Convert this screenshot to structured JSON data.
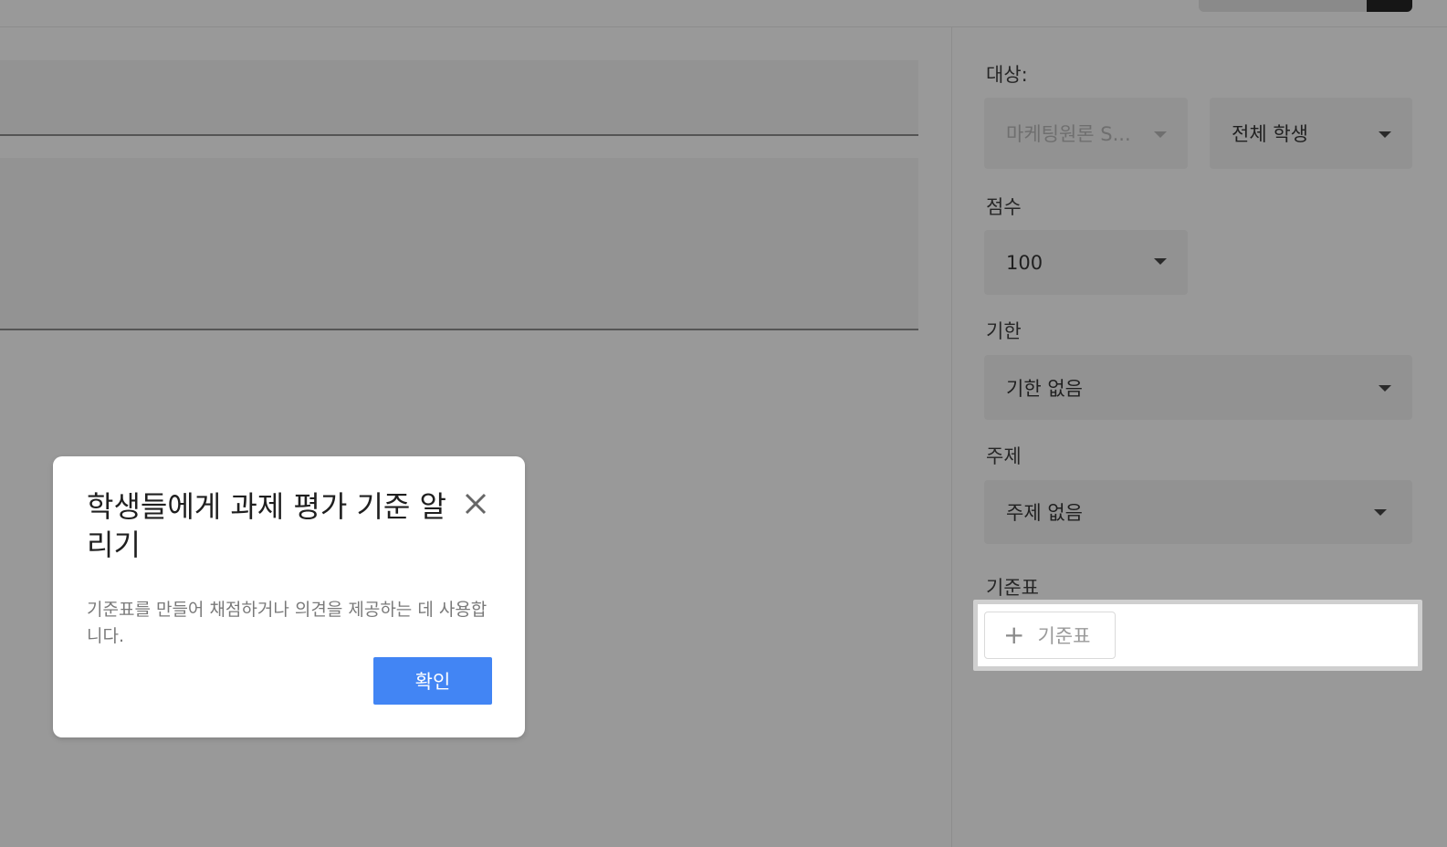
{
  "sidebar": {
    "target_label": "대상:",
    "class_dropdown": {
      "value": "마케팅원론 S..."
    },
    "students_dropdown": {
      "value": "전체 학생"
    },
    "points_label": "점수",
    "points_dropdown": {
      "value": "100"
    },
    "due_label": "기한",
    "due_dropdown": {
      "value": "기한 없음"
    },
    "topic_label": "주제",
    "topic_dropdown": {
      "value": "주제 없음"
    },
    "rubric_label": "기준표",
    "rubric_button_label": "기준표"
  },
  "dialog": {
    "title": "학생들에게 과제 평가 기준 알리기",
    "body": "기준표를 만들어 채점하거나 의견을 제공하는 데 사용합니다.",
    "confirm_label": "확인"
  },
  "colors": {
    "overlay_background": "#999999",
    "confirm_button": "#4285f4"
  }
}
